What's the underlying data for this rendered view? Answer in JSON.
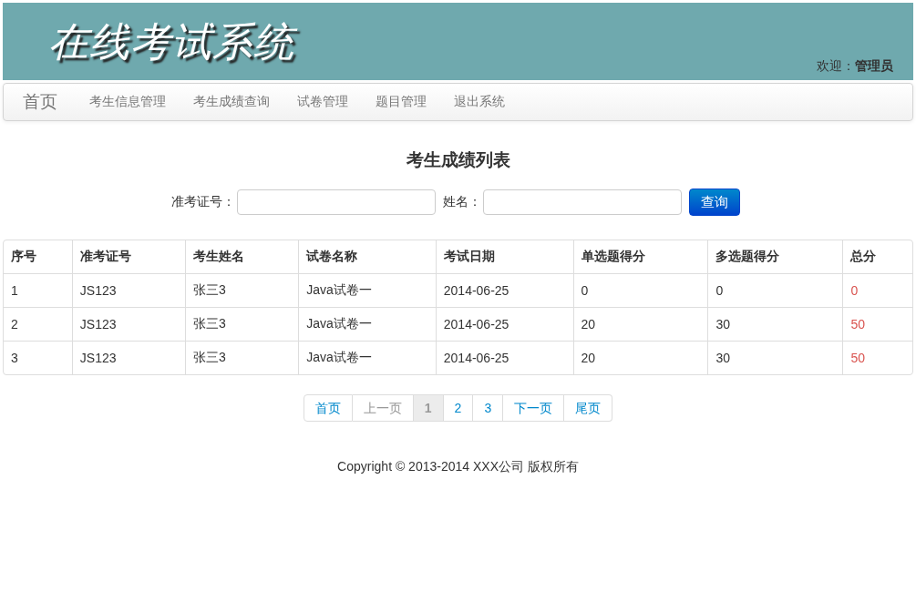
{
  "header": {
    "title": "在线考试系统",
    "welcome": "欢迎：**管理员**"
  },
  "nav": {
    "brand": "首页",
    "items": [
      {
        "label": "考生信息管理"
      },
      {
        "label": "考生成绩查询"
      },
      {
        "label": "试卷管理"
      },
      {
        "label": "题目管理"
      },
      {
        "label": "退出系统"
      }
    ]
  },
  "page_title": "考生成绩列表",
  "search": {
    "fields": [
      {
        "label": "准考证号："
      },
      {
        "label": "姓名："
      }
    ],
    "button": "查询"
  },
  "table": {
    "columns": [
      "序号",
      "准考证号",
      "考生姓名",
      "试卷名称",
      "考试日期",
      "单选题得分",
      "多选题得分",
      "总分"
    ],
    "rows": [
      [
        "1",
        "JS123",
        "张三3",
        "Java试卷一",
        "2014-06-25",
        "0",
        "0",
        "0"
      ],
      [
        "2",
        "JS123",
        "张三3",
        "Java试卷一",
        "2014-06-25",
        "20",
        "30",
        "50"
      ],
      [
        "3",
        "JS123",
        "张三3",
        "Java试卷一",
        "2014-06-25",
        "20",
        "30",
        "50"
      ]
    ]
  },
  "pagination": [
    {
      "label": "首页",
      "selected": false,
      "disabled": false
    },
    {
      "label": "上一页",
      "selected": false,
      "disabled": true
    },
    {
      "label": "1",
      "selected": true,
      "disabled": false
    },
    {
      "label": "2",
      "selected": false,
      "disabled": false
    },
    {
      "label": "3",
      "selected": false,
      "disabled": false
    },
    {
      "label": "下一页",
      "selected": false,
      "disabled": false
    },
    {
      "label": "尾页",
      "selected": false,
      "disabled": false
    }
  ],
  "footer": "Copyright © 2013-2014 XXX公司 版权所有"
}
